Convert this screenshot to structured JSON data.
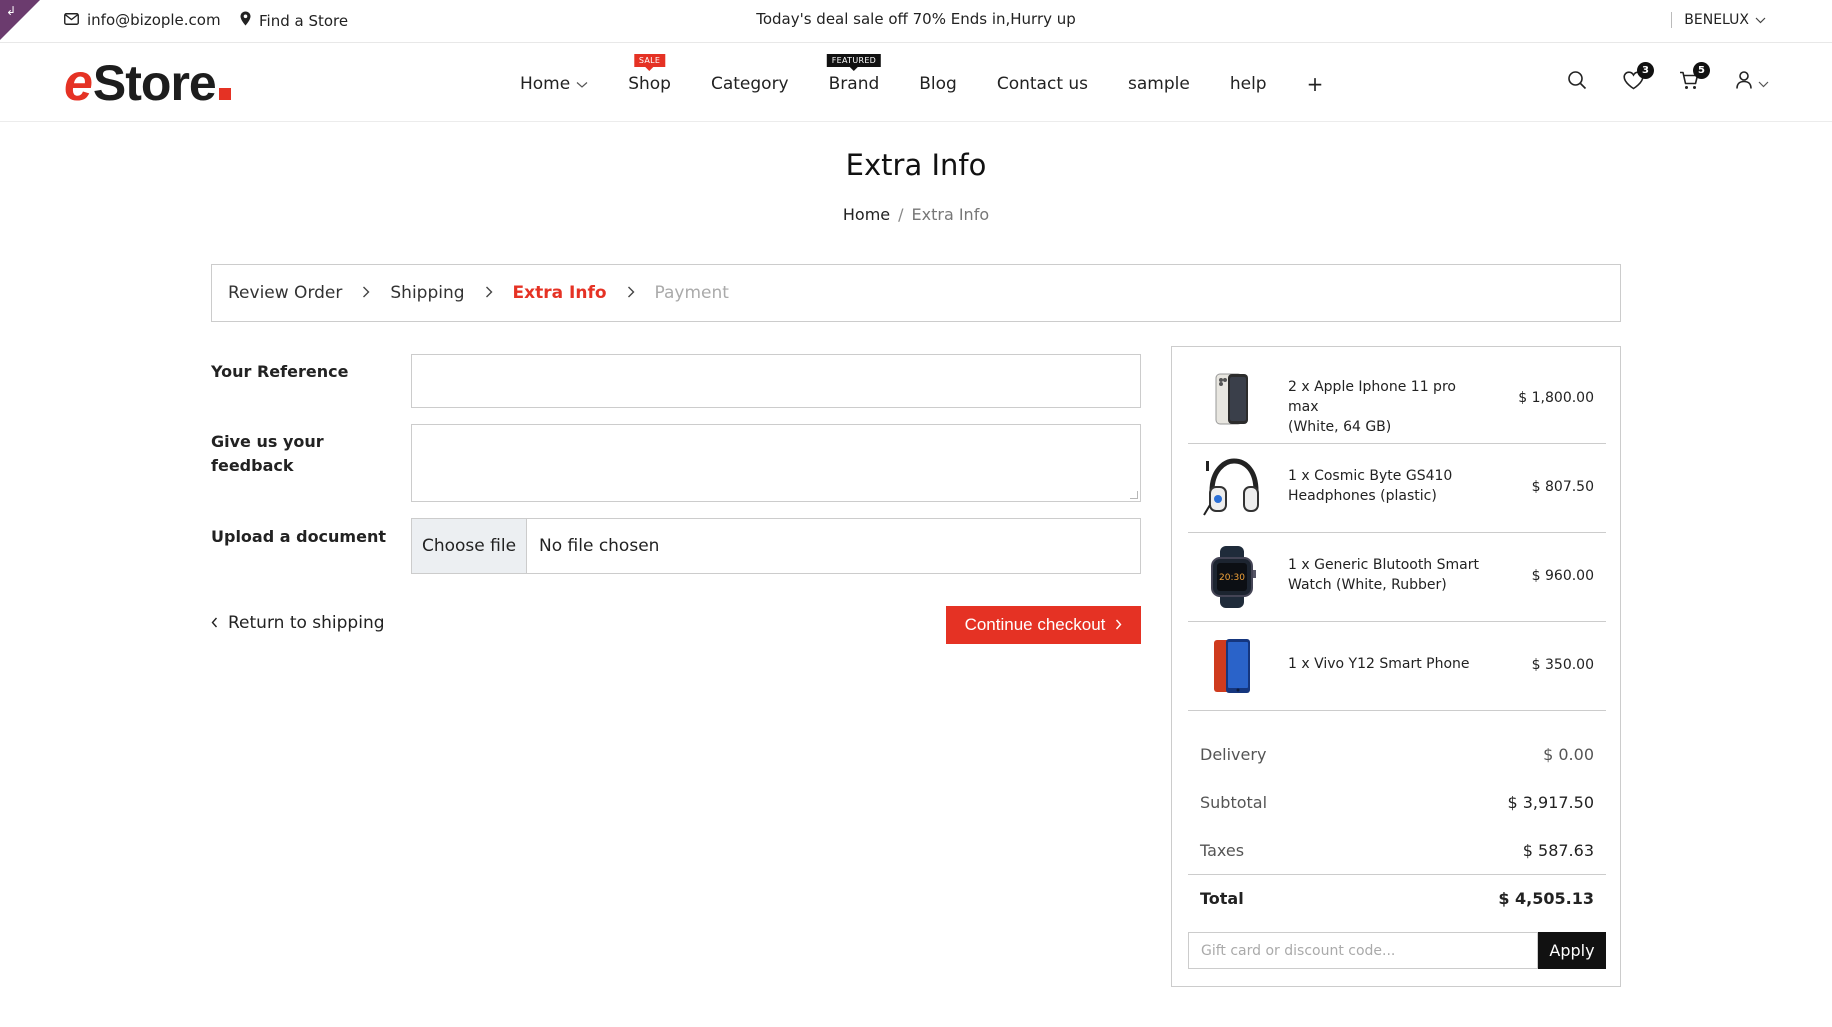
{
  "topbar": {
    "email": "info@bizople.com",
    "store_link": "Find a Store",
    "deal_text": "Today's deal sale off 70% Ends in,Hurry up",
    "region": "BENELUX"
  },
  "header": {
    "logo_first": "e",
    "logo_rest": "Store",
    "nav": [
      {
        "label": "Home",
        "has_dropdown": true
      },
      {
        "label": "Shop",
        "badge": "SALE"
      },
      {
        "label": "Category"
      },
      {
        "label": "Brand",
        "badge": "FEATURED"
      },
      {
        "label": "Blog"
      },
      {
        "label": "Contact us"
      },
      {
        "label": "sample"
      },
      {
        "label": "help"
      },
      {
        "label": "+"
      }
    ],
    "wishlist_count": "3",
    "cart_count": "5"
  },
  "page": {
    "title": "Extra Info",
    "breadcrumb_home": "Home",
    "breadcrumb_sep": "/",
    "breadcrumb_current": "Extra Info"
  },
  "steps": [
    {
      "label": "Review Order",
      "state": "done"
    },
    {
      "label": "Shipping",
      "state": "done"
    },
    {
      "label": "Extra Info",
      "state": "active"
    },
    {
      "label": "Payment",
      "state": "disabled"
    }
  ],
  "form": {
    "reference_label": "Your Reference",
    "reference_value": "",
    "feedback_label_1": "Give us your",
    "feedback_label_2": "feedback",
    "feedback_value": "",
    "upload_label": "Upload a document",
    "file_button": "Choose file",
    "file_status": "No file chosen",
    "return_label": "Return to shipping",
    "continue_label": "Continue checkout"
  },
  "summary": {
    "items": [
      {
        "qty": "2 x",
        "name_1": "2 x Apple Iphone 11 pro max",
        "name_2": "(White, 64 GB)",
        "price": "$ 1,800.00",
        "icon": "phone-icon"
      },
      {
        "qty": "1 x",
        "name_1": "1 x Cosmic Byte GS410",
        "name_2": "Headphones (plastic)",
        "price": "$ 807.50",
        "icon": "headphones-icon"
      },
      {
        "qty": "1 x",
        "name_1": "1 x Generic Blutooth Smart",
        "name_2": "Watch (White, Rubber)",
        "price": "$ 960.00",
        "icon": "smartwatch-icon"
      },
      {
        "qty": "1 x",
        "name_1": "1 x Vivo Y12 Smart Phone",
        "name_2": "",
        "price": "$ 350.00",
        "icon": "phone-icon"
      }
    ],
    "delivery_label": "Delivery",
    "delivery_value": "$ 0.00",
    "subtotal_label": "Subtotal",
    "subtotal_value": "$ 3,917.50",
    "taxes_label": "Taxes",
    "taxes_value": "$ 587.63",
    "total_label": "Total",
    "total_value": "$ 4,505.13",
    "discount_placeholder": "Gift card or discount code...",
    "apply_label": "Apply"
  },
  "colors": {
    "accent": "#e53224",
    "dark": "#111111",
    "corner": "#6b3b6e"
  }
}
